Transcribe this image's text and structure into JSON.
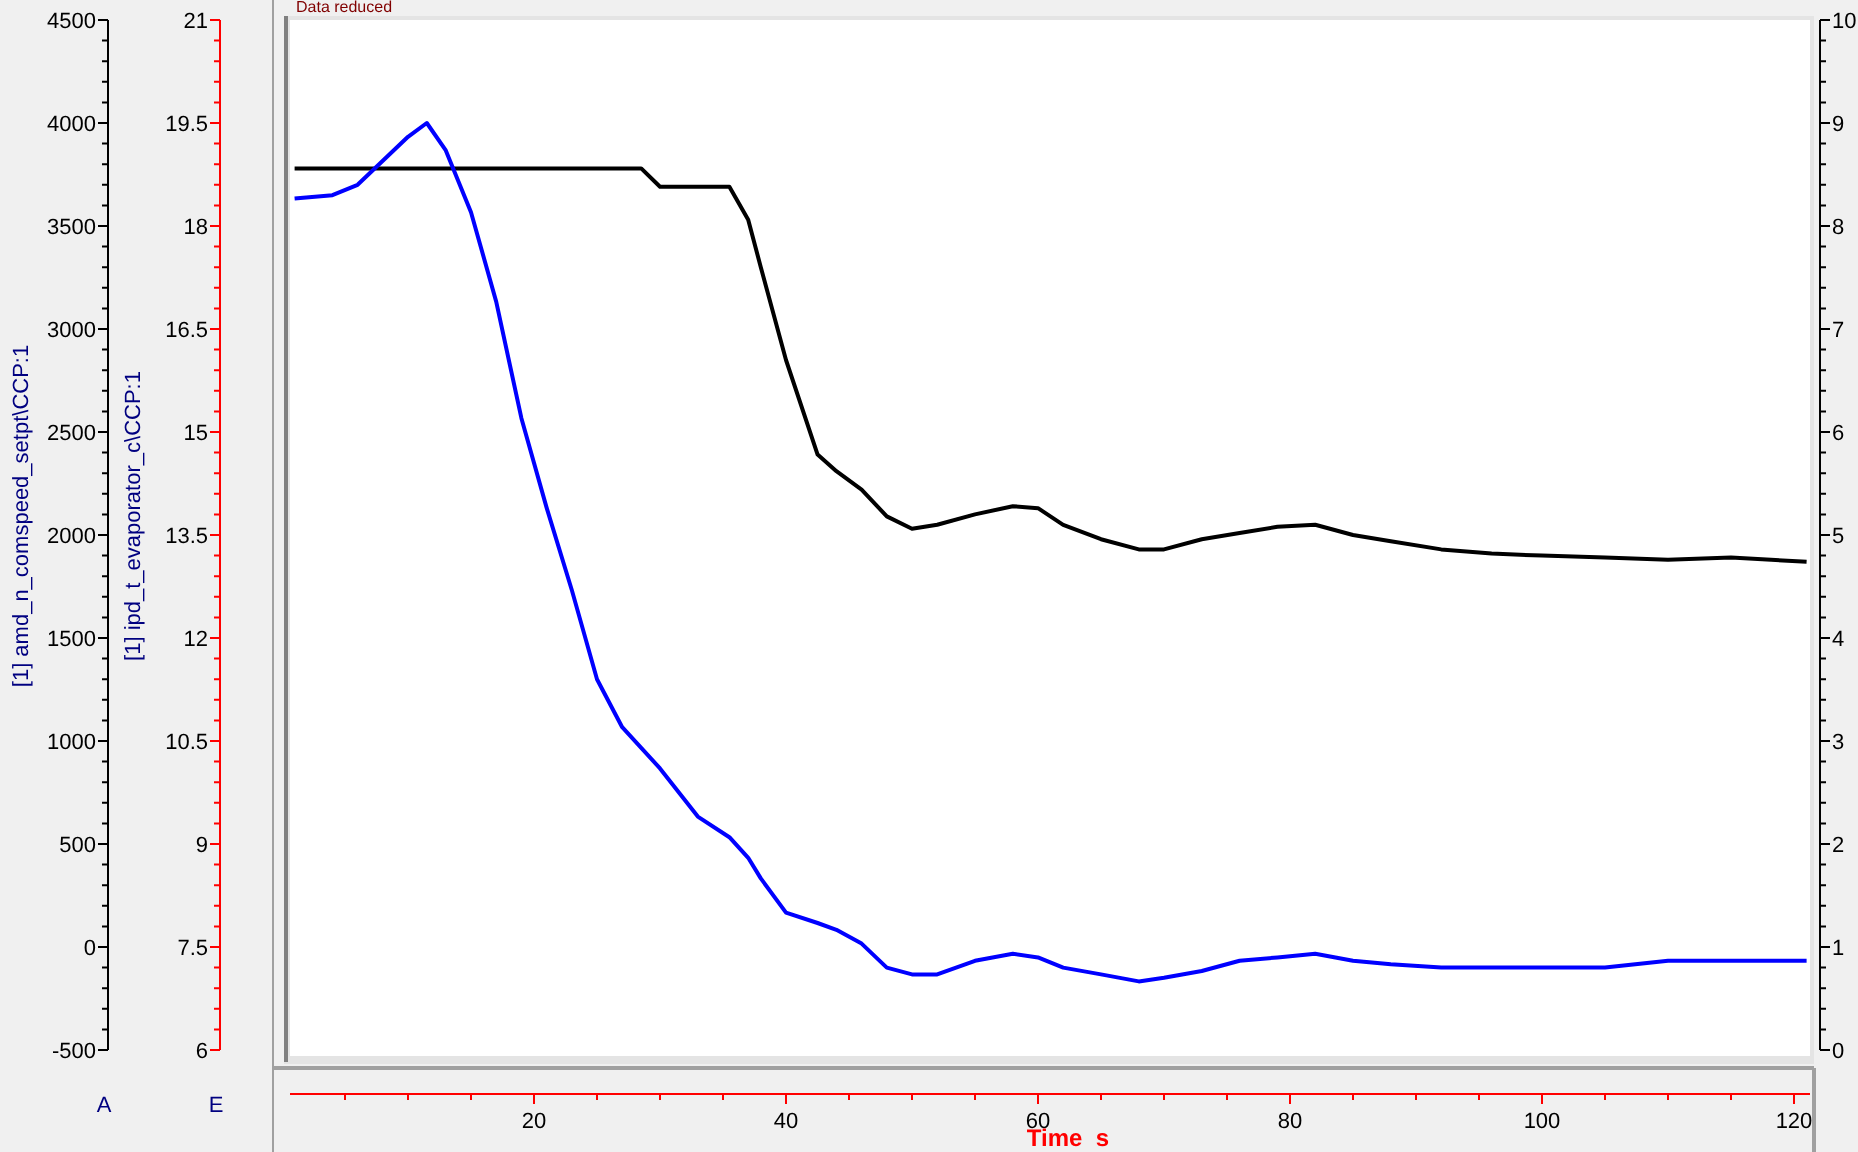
{
  "note": "Data reduced",
  "chart_data": {
    "type": "line",
    "xlabel": "Time  s",
    "xlim": [
      1,
      122
    ],
    "xticks": [
      20,
      40,
      60,
      80,
      100,
      120
    ],
    "ylabel": "[1] amd_n_comspeed_setpt\\CCP:1",
    "ylim": [
      -500,
      4500
    ],
    "yticks": [
      -500,
      0,
      500,
      1000,
      1500,
      2000,
      2500,
      3000,
      3500,
      4000,
      4500
    ],
    "y2lim": [
      0,
      10
    ],
    "y2ticks": [
      0,
      1,
      2,
      3,
      4,
      5,
      6,
      7,
      8,
      9,
      10
    ],
    "y3label": "[1] ipd_t_evaporator_c\\CCP:1",
    "y3lim": [
      6,
      21
    ],
    "y3ticks": [
      6,
      7.5,
      9,
      10.5,
      12,
      13.5,
      15,
      16.5,
      18,
      19.5,
      21
    ],
    "x": [
      1,
      4,
      6,
      8,
      10,
      11.5,
      13,
      15,
      17,
      19,
      21,
      23,
      25,
      27,
      28.5,
      30,
      33,
      35.5,
      37,
      38,
      40,
      42.5,
      44,
      46,
      48,
      50,
      52,
      55,
      58,
      60,
      62,
      65,
      68,
      70,
      73,
      76,
      79,
      82,
      85,
      88,
      92,
      96,
      100,
      105,
      110,
      115,
      121
    ],
    "series": [
      {
        "color": "#000000",
        "values": [
          3780,
          3780,
          3780,
          3780,
          3780,
          3780,
          3780,
          3780,
          3780,
          3780,
          3780,
          3780,
          3780,
          3780,
          3780,
          3690,
          3690,
          3690,
          3530,
          3300,
          2850,
          2390,
          2310,
          2220,
          2090,
          2030,
          2050,
          2100,
          2140,
          2130,
          2050,
          1980,
          1930,
          1930,
          1980,
          2010,
          2040,
          2050,
          2000,
          1970,
          1930,
          1910,
          1900,
          1890,
          1880,
          1890,
          1870
        ]
      },
      {
        "axis": "y3",
        "color": "#0000ff",
        "values": [
          18.4,
          18.45,
          18.6,
          18.95,
          19.3,
          19.5,
          19.1,
          18.2,
          16.9,
          15.2,
          13.9,
          12.7,
          11.4,
          10.7,
          10.4,
          10.1,
          9.4,
          9.1,
          8.8,
          8.5,
          8.0,
          7.85,
          7.75,
          7.55,
          7.2,
          7.1,
          7.1,
          7.3,
          7.4,
          7.35,
          7.2,
          7.1,
          7.0,
          7.05,
          7.15,
          7.3,
          7.35,
          7.4,
          7.3,
          7.25,
          7.2,
          7.2,
          7.2,
          7.2,
          7.3,
          7.3,
          7.3
        ]
      }
    ]
  },
  "axis_letters": [
    {
      "letter": "A",
      "color": "#000000"
    },
    {
      "letter": "E",
      "color": "#ff0000"
    }
  ]
}
